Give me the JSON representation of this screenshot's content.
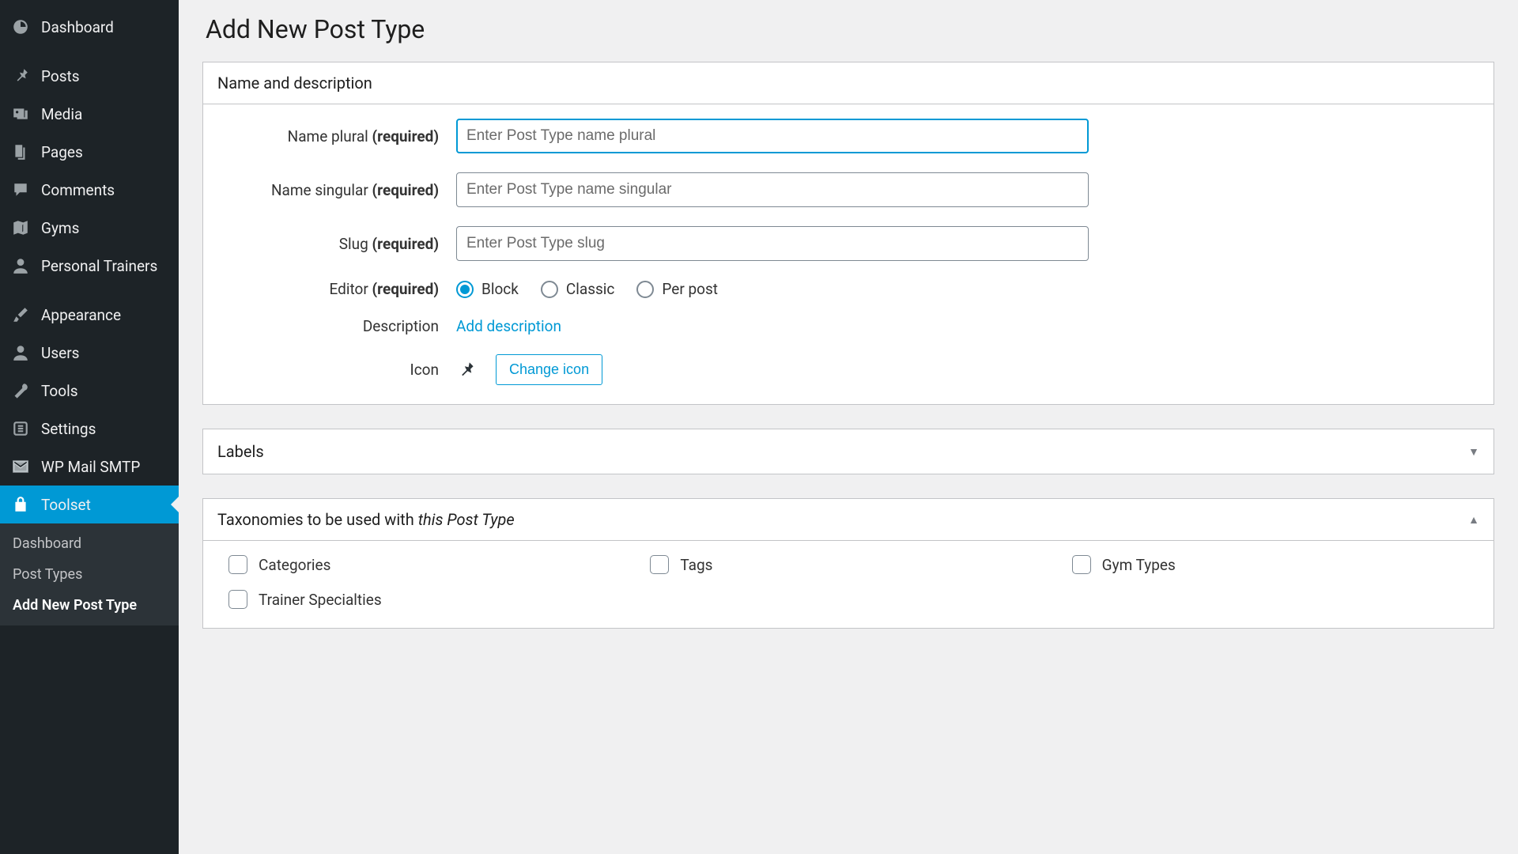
{
  "sidebar": {
    "items": [
      {
        "id": "dashboard",
        "label": "Dashboard",
        "icon": "dashboard-icon"
      },
      {
        "id": "posts",
        "label": "Posts",
        "icon": "pin-icon"
      },
      {
        "id": "media",
        "label": "Media",
        "icon": "media-icon"
      },
      {
        "id": "pages",
        "label": "Pages",
        "icon": "pages-icon"
      },
      {
        "id": "comments",
        "label": "Comments",
        "icon": "comments-icon"
      },
      {
        "id": "gyms",
        "label": "Gyms",
        "icon": "map-icon"
      },
      {
        "id": "personal-trainers",
        "label": "Personal Trainers",
        "icon": "user-icon"
      },
      {
        "id": "appearance",
        "label": "Appearance",
        "icon": "brush-icon"
      },
      {
        "id": "users",
        "label": "Users",
        "icon": "user-icon"
      },
      {
        "id": "tools",
        "label": "Tools",
        "icon": "wrench-icon"
      },
      {
        "id": "settings",
        "label": "Settings",
        "icon": "sliders-icon"
      },
      {
        "id": "wp-mail-smtp",
        "label": "WP Mail SMTP",
        "icon": "mail-icon"
      },
      {
        "id": "toolset",
        "label": "Toolset",
        "icon": "toolset-icon",
        "active": true
      }
    ],
    "submenu": [
      {
        "label": "Dashboard",
        "current": false
      },
      {
        "label": "Post Types",
        "current": false
      },
      {
        "label": "Add New Post Type",
        "current": true
      }
    ]
  },
  "page": {
    "title": "Add New Post Type"
  },
  "panels": {
    "name": {
      "title": "Name and description"
    },
    "labels": {
      "title": "Labels"
    },
    "taxonomies": {
      "title_a": "Taxonomies to be used with ",
      "title_b": "this Post Type"
    }
  },
  "fields": {
    "name_plural": {
      "label": "Name plural",
      "required": "(required)",
      "placeholder": "Enter Post Type name plural"
    },
    "name_singular": {
      "label": "Name singular",
      "required": "(required)",
      "placeholder": "Enter Post Type name singular"
    },
    "slug": {
      "label": "Slug",
      "required": "(required)",
      "placeholder": "Enter Post Type slug"
    },
    "editor": {
      "label": "Editor",
      "required": "(required)",
      "options": [
        {
          "label": "Block",
          "checked": true
        },
        {
          "label": "Classic",
          "checked": false
        },
        {
          "label": "Per post",
          "checked": false
        }
      ]
    },
    "description": {
      "label": "Description",
      "action": "Add description"
    },
    "icon": {
      "label": "Icon",
      "button": "Change icon"
    }
  },
  "taxonomies": [
    {
      "label": "Categories"
    },
    {
      "label": "Tags"
    },
    {
      "label": "Gym Types"
    },
    {
      "label": "Trainer Specialties"
    }
  ]
}
